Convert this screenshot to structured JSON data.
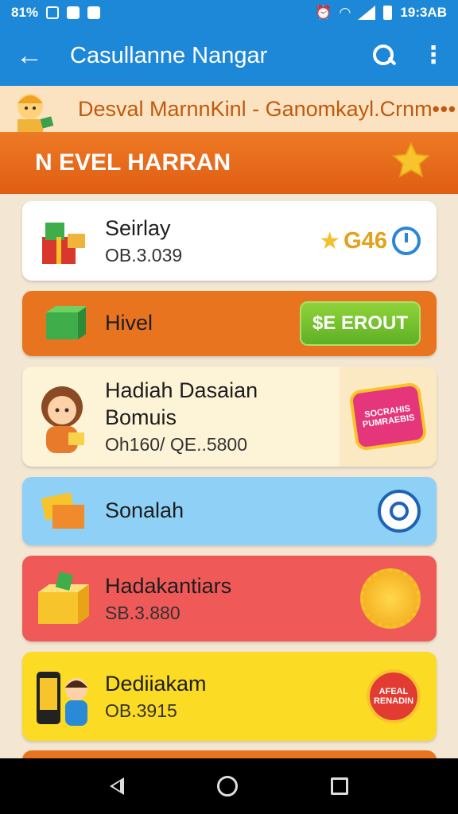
{
  "status_bar": {
    "left_text": "81%",
    "time": "19:3AB"
  },
  "app_bar": {
    "back_glyph": "←",
    "title": "Casullanne Nangar",
    "more_glyph": "⋮"
  },
  "promo": {
    "text": "Desval MarnnKinl - Ganomkayl.Crnm",
    "more_glyph": "•••"
  },
  "heading": {
    "title": "N EVEL HARRAN",
    "star_glyph": "★"
  },
  "cards": [
    {
      "name": "Seirlay",
      "sub": "OB.3.039",
      "rating": "G46",
      "star_glyph": "★"
    },
    {
      "name": "Hivel",
      "button": "$E EROUT"
    },
    {
      "name": "Hadiah Dasaian\nBomuis",
      "sub": "Oh160/ QE..5800",
      "badge": "SOCRAHIS PUMRAEBIS"
    },
    {
      "name": "Sonalah"
    },
    {
      "name": "Hadakantiars",
      "sub": "SB.3.880"
    },
    {
      "name": "Dediiakam",
      "sub": "OB.3915",
      "badge": "AFEAL RENADIN"
    }
  ],
  "colors": {
    "primary": "#1e88d8",
    "heading": "#e86a1c",
    "green": "#6cbf2a",
    "red": "#ef5957",
    "yellow": "#fbdb24",
    "blue_light": "#8ed0f6"
  },
  "icons": [
    "back-arrow-icon",
    "search-icon",
    "more-vert-icon",
    "star-icon",
    "timer-icon",
    "badge-icon",
    "gold-medal-icon"
  ]
}
